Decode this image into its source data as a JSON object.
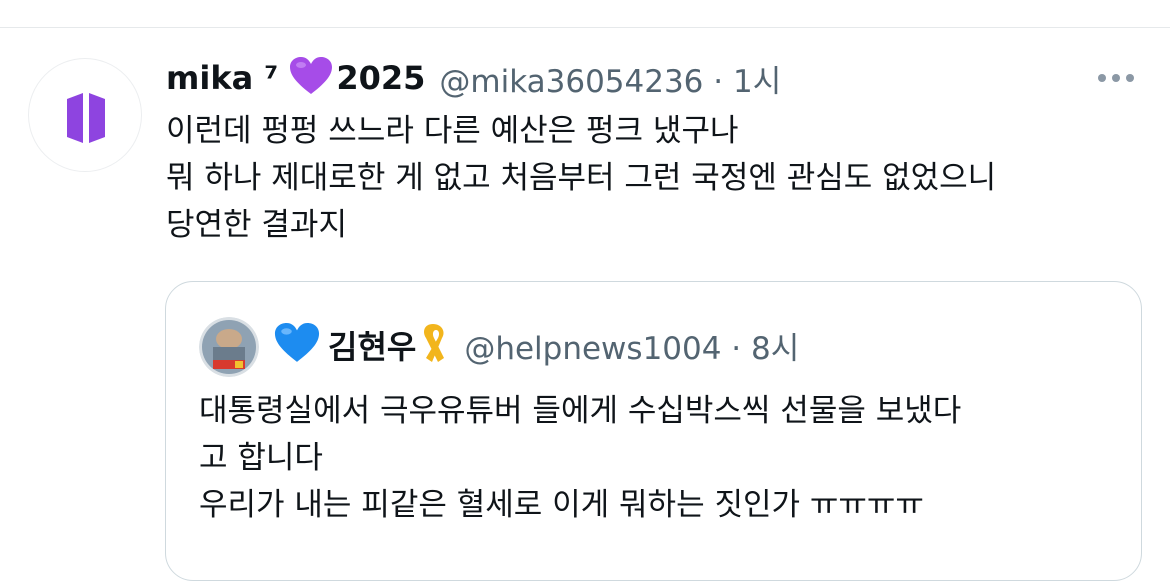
{
  "tweet": {
    "display_name": "mika ⁷",
    "name_emoji": "purple-heart-icon",
    "name_suffix": "2025",
    "handle_time": "@mika36054236 · 1시",
    "lines": [
      "이런데 펑펑 쓰느라 다른 예산은 펑크 냈구나",
      "뭐 하나 제대로한 게 없고 처음부터 그런 국정엔 관심도 없었으니",
      "당연한 결과지"
    ]
  },
  "quote": {
    "display_name": "김현우",
    "name_emoji_before": "blue-heart-icon",
    "name_emoji_after": "yellow-ribbon-icon",
    "handle_time": "@helpnews1004 · 8시",
    "lines": [
      "대통령실에서 극우유튜버 들에게 수십박스씩 선물을 보냈다",
      "고 합니다",
      "우리가 내는 피같은 혈세로 이게 뭐하는 짓인가 ㅠㅠㅠㅠ"
    ]
  },
  "colors": {
    "text": "#0f1419",
    "secondary": "#536471",
    "border": "#cfd9de",
    "purple": "#8e44e0",
    "blue": "#1d8cf0",
    "ribbon": "#f2b51c"
  }
}
